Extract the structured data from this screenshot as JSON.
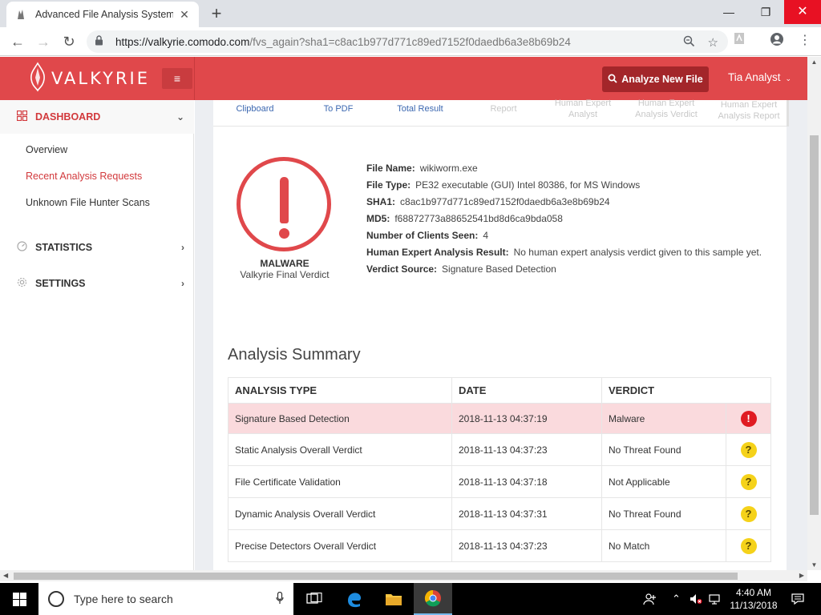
{
  "browser": {
    "tab_title": "Advanced File Analysis System | V",
    "tab_close": "✕",
    "new_tab": "+",
    "url_host": "https://valkyrie.comodo.com",
    "url_path": "/fvs_again?sha1=c8ac1b977d771c89ed7152f0daedb6a3e8b69b24",
    "window_min": "—",
    "window_max": "❐",
    "window_close": "✕"
  },
  "header": {
    "brand": "VALKYRIE",
    "analyze_button": "Analyze New File",
    "user": "Tia Analyst",
    "accent_color": "#e0484b"
  },
  "sidebar": {
    "dashboard": "DASHBOARD",
    "items": [
      "Overview",
      "Recent Analysis Requests",
      "Unknown File Hunter Scans"
    ],
    "statistics": "STATISTICS",
    "settings": "SETTINGS"
  },
  "tools": [
    {
      "lines": [
        "Clipboard"
      ],
      "enabled": true
    },
    {
      "lines": [
        "To PDF"
      ],
      "enabled": true
    },
    {
      "lines": [
        "Total Result"
      ],
      "enabled": true
    },
    {
      "lines": [
        "Report"
      ],
      "enabled": false
    },
    {
      "lines": [
        "Human Expert",
        "Analyst"
      ],
      "enabled": false
    },
    {
      "lines": [
        "Human Expert",
        "Analysis Verdict"
      ],
      "enabled": false
    },
    {
      "lines": [
        "Human Expert",
        "Analysis Report"
      ],
      "enabled": false
    }
  ],
  "verdict": {
    "label": "MALWARE",
    "sub": "Valkyrie Final Verdict"
  },
  "file_info": [
    {
      "key": "File Name:",
      "value": "wikiworm.exe"
    },
    {
      "key": "File Type:",
      "value": "PE32 executable (GUI) Intel 80386, for MS Windows"
    },
    {
      "key": "SHA1:",
      "value": "c8ac1b977d771c89ed7152f0daedb6a3e8b69b24"
    },
    {
      "key": "MD5:",
      "value": "f68872773a88652541bd8d6ca9bda058"
    },
    {
      "key": "Number of Clients Seen:",
      "value": "4"
    },
    {
      "key": "Human Expert Analysis Result:",
      "value": "No human expert analysis verdict given to this sample yet."
    },
    {
      "key": "Verdict Source:",
      "value": "Signature Based Detection"
    }
  ],
  "summary": {
    "title": "Analysis Summary",
    "headers": [
      "ANALYSIS TYPE",
      "DATE",
      "VERDICT"
    ],
    "rows": [
      {
        "type": "Signature Based Detection",
        "date": "2018-11-13 04:37:19",
        "verdict": "Malware",
        "icon": "!",
        "severity": "red"
      },
      {
        "type": "Static Analysis Overall Verdict",
        "date": "2018-11-13 04:37:23",
        "verdict": "No Threat Found",
        "icon": "?",
        "severity": "yellow"
      },
      {
        "type": "File Certificate Validation",
        "date": "2018-11-13 04:37:18",
        "verdict": "Not Applicable",
        "icon": "?",
        "severity": "yellow"
      },
      {
        "type": "Dynamic Analysis Overall Verdict",
        "date": "2018-11-13 04:37:31",
        "verdict": "No Threat Found",
        "icon": "?",
        "severity": "yellow"
      },
      {
        "type": "Precise Detectors Overall Verdict",
        "date": "2018-11-13 04:37:23",
        "verdict": "No Match",
        "icon": "?",
        "severity": "yellow"
      }
    ]
  },
  "taskbar": {
    "search_placeholder": "Type here to search",
    "time": "4:40 AM",
    "date": "11/13/2018"
  }
}
